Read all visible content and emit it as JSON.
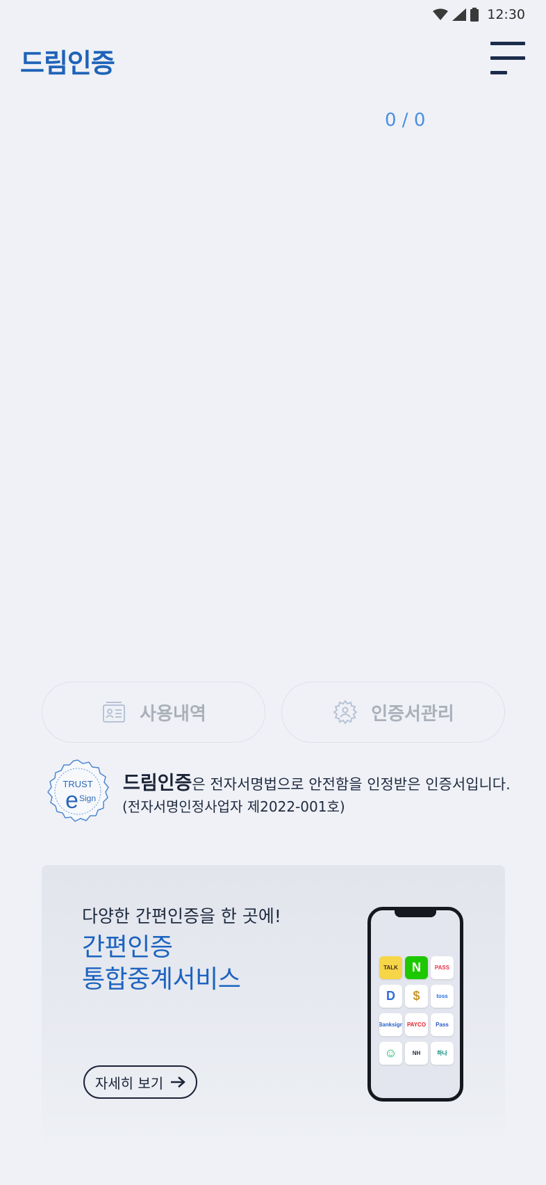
{
  "status_bar": {
    "time": "12:30",
    "icons": [
      "wifi-icon",
      "cellular-signal-icon",
      "battery-icon"
    ]
  },
  "header": {
    "title": "드림인증",
    "menu_icon": "hamburger-menu-icon"
  },
  "page_counter": "0 / 0",
  "actions": [
    {
      "label": "사용내역",
      "icon": "usage-history-icon"
    },
    {
      "label": "인증서관리",
      "icon": "certificate-settings-gear-icon"
    }
  ],
  "trust": {
    "seal_top": "TRUST",
    "seal_bottom": "Sign",
    "brand": "드림인증",
    "statement": "은 전자서명법으로 안전함을 인정받은 인증서입니다.",
    "license": "(전자서명인정사업자 제2022-001호)"
  },
  "banner": {
    "tagline": "다양한 간편인증을 한 곳에!",
    "title_line1": "간편인증",
    "title_line2": "통합중계서비스",
    "more_button": "자세히 보기",
    "apps": [
      {
        "label": "TALK",
        "icon": "kakao-talk-icon",
        "color": "#3b2a1a",
        "bg": "#f7d548"
      },
      {
        "label": "N",
        "icon": "naver-icon",
        "color": "#ffffff",
        "bg": "#1ec800"
      },
      {
        "label": "PASS",
        "icon": "pass-red-icon",
        "color": "#e8344d",
        "bg": "#ffffff"
      },
      {
        "label": "D",
        "icon": "shield-d-icon",
        "color": "#2f6fd6",
        "bg": "#ffffff"
      },
      {
        "label": "$",
        "icon": "payco-lock-icon",
        "color": "#c9962b",
        "bg": "#ffffff"
      },
      {
        "label": "toss",
        "icon": "toss-icon",
        "color": "#2a6fe0",
        "bg": "#ffffff"
      },
      {
        "label": "Banksign",
        "icon": "banksign-icon",
        "color": "#2a62c4",
        "bg": "#ffffff"
      },
      {
        "label": "PAYCO",
        "icon": "payco-icon",
        "color": "#e21f2a",
        "bg": "#ffffff"
      },
      {
        "label": "Pass",
        "icon": "pass-blue-icon",
        "color": "#2d55c9",
        "bg": "#ffffff"
      },
      {
        "label": "☺",
        "icon": "smile-green-icon",
        "color": "#19b56a",
        "bg": "#ffffff"
      },
      {
        "label": "NH",
        "icon": "nh-bank-icon",
        "color": "#1e2a3f",
        "bg": "#ffffff"
      },
      {
        "label": "하나",
        "icon": "hana-bank-icon",
        "color": "#0a8a7a",
        "bg": "#ffffff"
      }
    ]
  }
}
